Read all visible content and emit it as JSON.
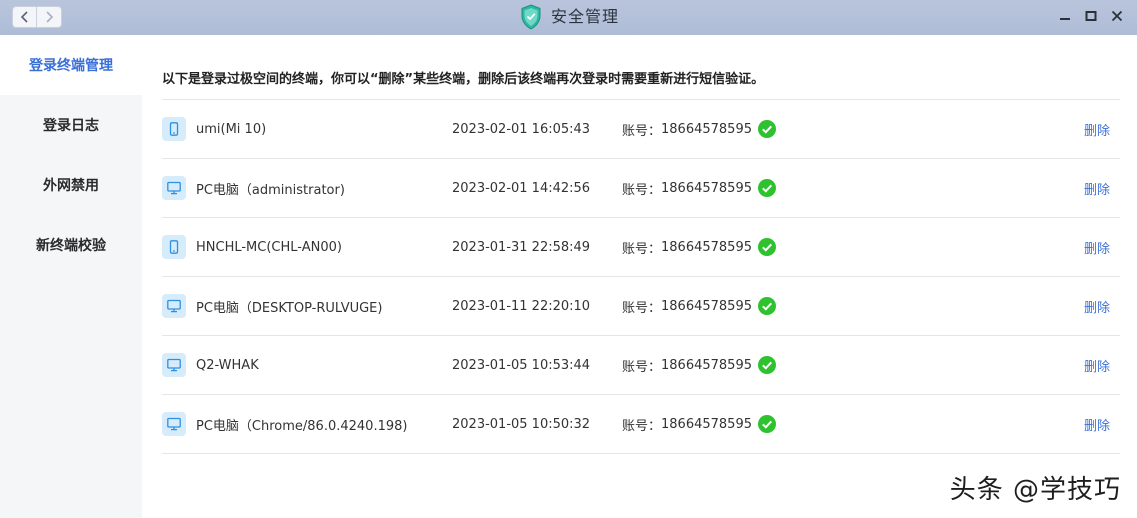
{
  "window": {
    "title": "安全管理"
  },
  "sidebar": {
    "items": [
      {
        "label": "登录终端管理",
        "active": true
      },
      {
        "label": "登录日志"
      },
      {
        "label": "外网禁用"
      },
      {
        "label": "新终端校验"
      }
    ]
  },
  "main": {
    "description": "以下是登录过极空间的终端，你可以“删除”某些终端，删除后该终端再次登录时需要重新进行短信验证。",
    "account_prefix": "账号：",
    "delete_label": "删除",
    "rows": [
      {
        "device_type": "phone",
        "name": "umi(Mi 10)",
        "time": "2023-02-01 16:05:43",
        "account": "18664578595"
      },
      {
        "device_type": "pc",
        "name": "PC电脑（administrator)",
        "time": "2023-02-01 14:42:56",
        "account": "18664578595"
      },
      {
        "device_type": "phone",
        "name": "HNCHL-MC(CHL-AN00)",
        "time": "2023-01-31 22:58:49",
        "account": "18664578595"
      },
      {
        "device_type": "pc",
        "name": "PC电脑（DESKTOP-RULVUGE)",
        "time": "2023-01-11 22:20:10",
        "account": "18664578595"
      },
      {
        "device_type": "pc",
        "name": "Q2-WHAK",
        "time": "2023-01-05 10:53:44",
        "account": "18664578595"
      },
      {
        "device_type": "pc",
        "name": "PC电脑（Chrome/86.0.4240.198)",
        "time": "2023-01-05 10:50:32",
        "account": "18664578595"
      }
    ]
  },
  "watermark": "头条 @学技巧",
  "colors": {
    "accent": "#3a6fd8",
    "verified": "#2fc22f",
    "titlebar": "#b3c0d9"
  }
}
